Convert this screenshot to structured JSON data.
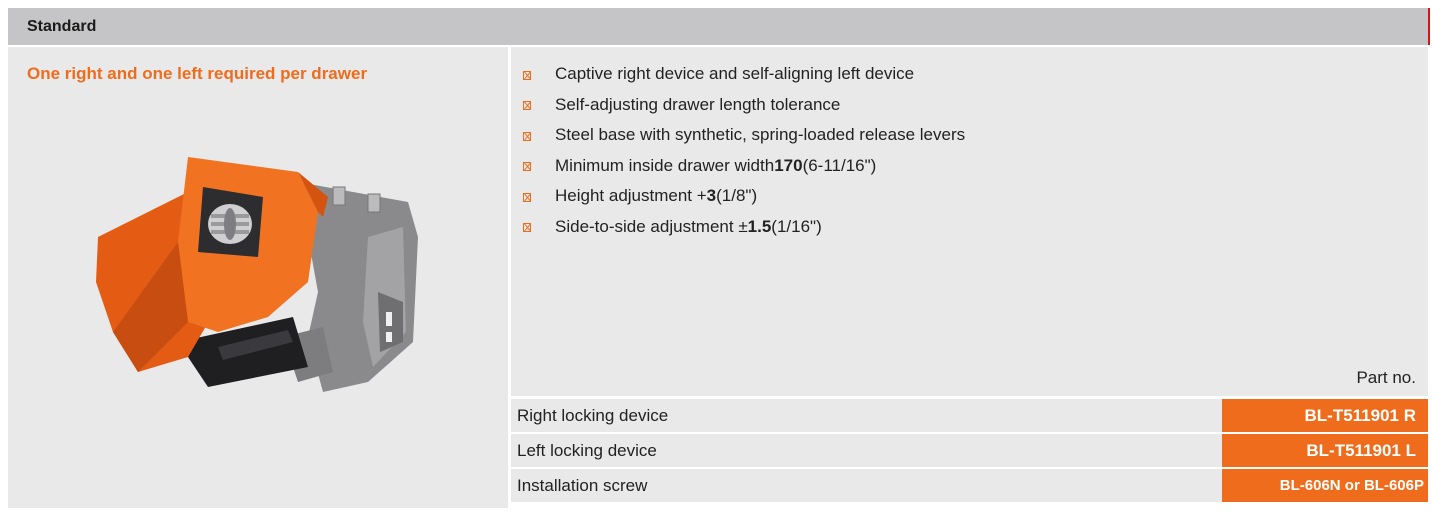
{
  "header": {
    "title": "Standard"
  },
  "product": {
    "subtitle": "One right and one left required per drawer",
    "image_icon": "drawer-locking-device-image"
  },
  "features": [
    {
      "pre": "Captive right device and self-aligning left device",
      "bold": "",
      "post": ""
    },
    {
      "pre": "Self-adjusting drawer length tolerance",
      "bold": "",
      "post": ""
    },
    {
      "pre": "Steel base with synthetic, spring-loaded release levers",
      "bold": "",
      "post": ""
    },
    {
      "pre": "Minimum inside drawer width ",
      "bold": "170",
      "post": " (6-11/16\")"
    },
    {
      "pre": "Height adjustment +",
      "bold": "3",
      "post": " (1/8\")"
    },
    {
      "pre": "Side-to-side adjustment ±",
      "bold": "1.5",
      "post": " (1/16\")"
    }
  ],
  "parts": {
    "column_label": "Part no.",
    "rows": [
      {
        "name": "Right locking device",
        "code": "BL-T511901 R"
      },
      {
        "name": "Left locking device",
        "code": "BL-T511901 L"
      },
      {
        "name": "Installation screw",
        "code": "BL-606N or BL-606P"
      }
    ]
  },
  "colors": {
    "accent": "#ef6c1c",
    "header_bg": "#c5c5c7",
    "panel_bg": "#e9e9ea",
    "edge": "#d6121c"
  }
}
